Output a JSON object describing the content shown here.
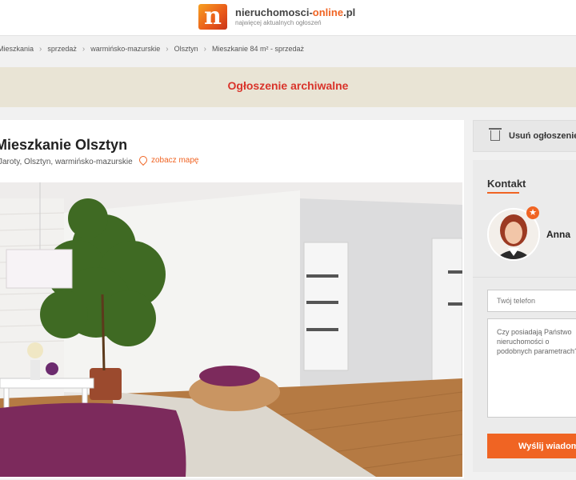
{
  "header": {
    "logo_mark": "n",
    "logo_text_main": "nieruchomosci-",
    "logo_text_accent": "online",
    "logo_text_suffix": ".pl",
    "tagline": "najwięcej aktualnych ogłoszeń"
  },
  "breadcrumb": {
    "items": [
      "Mieszkania",
      "sprzedaż",
      "warmińsko-mazurskie",
      "Olsztyn"
    ],
    "current": "Mieszkanie 84 m² - sprzedaż"
  },
  "archive": {
    "label": "Ogłoszenie archiwalne"
  },
  "listing": {
    "title": "Mieszkanie Olsztyn",
    "location": "Jaroty, Olsztyn, warmińsko-mazurskie",
    "map_link": "zobacz mapę"
  },
  "sidebar": {
    "delete_label": "Usuń ogłoszenie",
    "contact_title": "Kontakt",
    "agent_name": "Anna",
    "phone_placeholder": "Twój telefon",
    "message_text": "Czy posiadają Państwo nieruchomości o podobnych parametrach?",
    "send_label": "Wyślij wiadomość"
  },
  "colors": {
    "accent": "#f06423",
    "archive_text": "#d9342b",
    "archive_bg": "#e9e4d5"
  }
}
